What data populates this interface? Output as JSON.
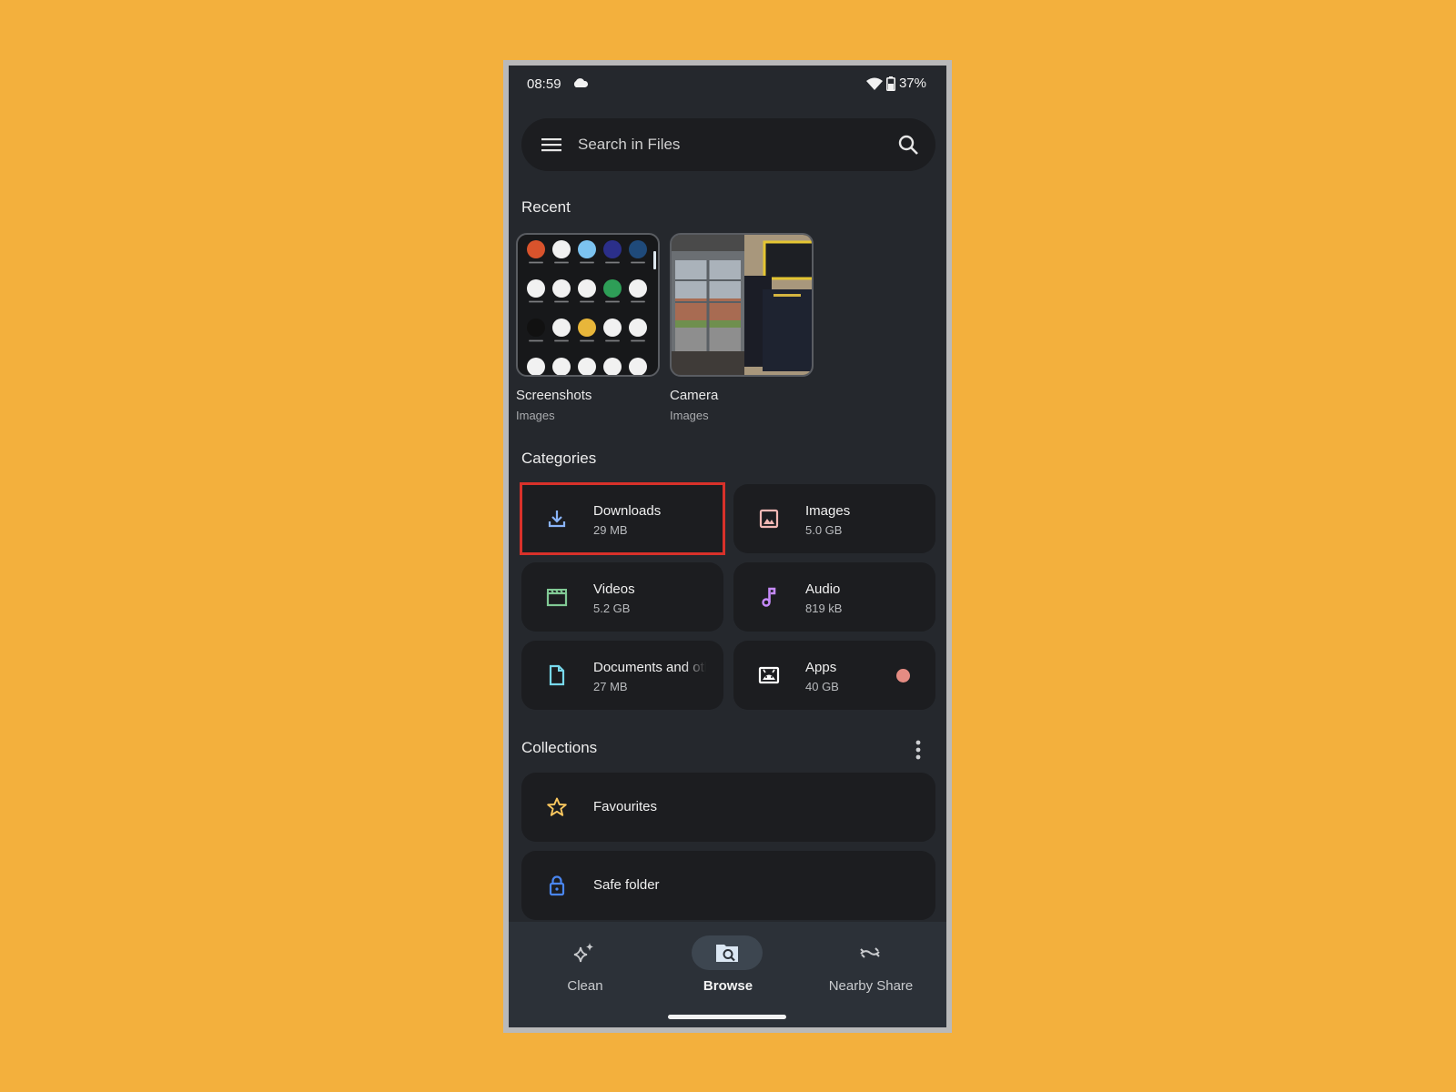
{
  "status_bar": {
    "time": "08:59",
    "battery": "37%",
    "icons": [
      "cloud-icon",
      "wifi-icon",
      "battery-icon"
    ]
  },
  "search": {
    "placeholder": "Search in Files"
  },
  "recent": {
    "title": "Recent",
    "items": [
      {
        "name": "Screenshots",
        "type": "Images"
      },
      {
        "name": "Camera",
        "type": "Images"
      }
    ]
  },
  "categories": {
    "title": "Categories",
    "items": [
      {
        "name": "Downloads",
        "size": "29 MB",
        "icon": "download-icon",
        "color": "#8ab4f8",
        "selected": true
      },
      {
        "name": "Images",
        "size": "5.0 GB",
        "icon": "image-icon",
        "color": "#f2b8b5"
      },
      {
        "name": "Videos",
        "size": "5.2 GB",
        "icon": "video-icon",
        "color": "#81c995"
      },
      {
        "name": "Audio",
        "size": "819 kB",
        "icon": "music-note-icon",
        "color": "#c58af9"
      },
      {
        "name": "Documents and other",
        "size": "27 MB",
        "icon": "document-icon",
        "color": "#78d9ec"
      },
      {
        "name": "Apps",
        "size": "40 GB",
        "icon": "android-icon",
        "color": "#ffffff",
        "badge_color": "#e58c83"
      }
    ]
  },
  "collections": {
    "title": "Collections",
    "items": [
      {
        "name": "Favourites",
        "icon": "star-icon",
        "color": "#fdc95f"
      },
      {
        "name": "Safe folder",
        "icon": "lock-icon",
        "color": "#4a86f0"
      }
    ]
  },
  "bottom_nav": {
    "items": [
      {
        "label": "Clean",
        "icon": "sparkle-icon",
        "active": false
      },
      {
        "label": "Browse",
        "icon": "folder-search-icon",
        "active": true
      },
      {
        "label": "Nearby Share",
        "icon": "nearby-share-icon",
        "active": false
      }
    ]
  },
  "colors": {
    "background": "#f3b03d",
    "screen": "#25282d",
    "card": "#1c1d20",
    "highlight": "#d8312a"
  }
}
